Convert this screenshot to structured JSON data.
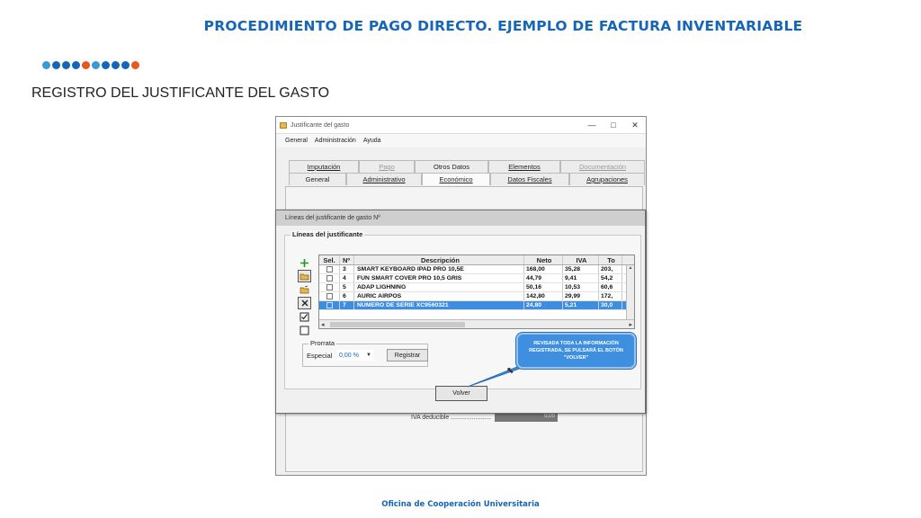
{
  "slide": {
    "title": "PROCEDIMIENTO DE PAGO DIRECTO. EJEMPLO DE FACTURA INVENTARIABLE",
    "subtitle": "REGISTRO DEL JUSTIFICANTE DEL GASTO",
    "footer": "Oficina de Cooperación Universitaria",
    "dot_colors": [
      "#3a9ad9",
      "#1565b8",
      "#1565b8",
      "#1565b8",
      "#e8571e",
      "#3a9ad9",
      "#1565b8",
      "#1565b8",
      "#1565b8",
      "#e8571e"
    ]
  },
  "main_window": {
    "title": "Justificante del gasto",
    "controls": [
      "—",
      "□",
      "✕"
    ],
    "menu": [
      "General",
      "Administración",
      "Ayuda"
    ],
    "tabs_row1": [
      {
        "label": "Imputación",
        "disabled": false
      },
      {
        "label": "Pago",
        "disabled": true
      },
      {
        "label": "Otros Datos",
        "disabled": false
      },
      {
        "label": "Elementos",
        "disabled": false
      },
      {
        "label": "Documentación",
        "disabled": true
      }
    ],
    "tabs_row2": [
      {
        "label": "General",
        "disabled": false
      },
      {
        "label": "Administrativo",
        "disabled": false
      },
      {
        "label": "Económico",
        "disabled": false,
        "active": true
      },
      {
        "label": "Datos Fiscales",
        "disabled": false
      },
      {
        "label": "Agrupaciones",
        "disabled": false
      }
    ],
    "iva_label": "IVA deducible .......................",
    "iva_value": "0,00"
  },
  "dialog": {
    "title": "Líneas del justificante de gasto Nº",
    "group_label": "Líneas del justificante",
    "columns": [
      "Sel.",
      "Nº",
      "Descripción",
      "Neto",
      "IVA",
      "To"
    ],
    "rows": [
      {
        "n": "3",
        "desc": "SMART KEYBOARD IPAD PRO 10,5E",
        "neto": "168,00",
        "iva": "35,28",
        "total": "203,",
        "selected": false
      },
      {
        "n": "4",
        "desc": "FUN SMART COVER PRO 10,5 GRIS",
        "neto": "44,79",
        "iva": "9,41",
        "total": "54,2",
        "selected": false
      },
      {
        "n": "5",
        "desc": "ADAP LIGHNING",
        "neto": "50,16",
        "iva": "10,53",
        "total": "60,6",
        "selected": false
      },
      {
        "n": "6",
        "desc": "AURIC AIRPOS",
        "neto": "142,80",
        "iva": "29,99",
        "total": "172,",
        "selected": false
      },
      {
        "n": "7",
        "desc": "NUMERO DE SERIE XC9560321",
        "neto": "24,80",
        "iva": "5,21",
        "total": "30,0",
        "selected": true
      }
    ],
    "tool_icons": [
      "add-icon",
      "open-icon",
      "edit-icon",
      "delete-icon",
      "check-all-icon",
      "uncheck-all-icon"
    ],
    "prorrata_label": "Prorrata",
    "especial_label": "Especial",
    "especial_value": "0,00 %",
    "registrar_label": "Registrar",
    "volver_label": "Volver"
  },
  "callout": {
    "text": "REVISADA TODA LA INFORMACIÓN REGISTRADA, SE PULSARÁ EL BOTÓN \"VOLVER\""
  }
}
